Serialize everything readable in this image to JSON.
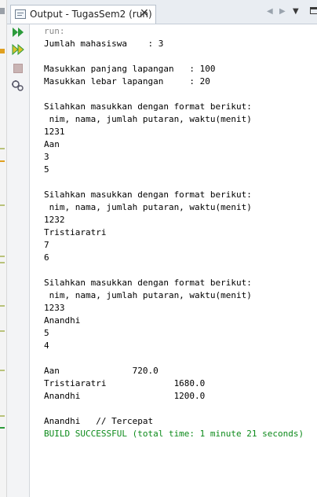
{
  "tab": {
    "title": "Output - TugasSem2 (run)",
    "close_glyph": "✕"
  },
  "nav": {
    "prev_glyph": "◀",
    "next_glyph": "▶",
    "menu_glyph": "▼"
  },
  "toolbar": {
    "rerun_icon": "double-play-icon",
    "rerun_options_icon": "double-play-outline-icon",
    "stop_icon": "stop-icon",
    "settings_icon": "settings-icon",
    "accent": "#2c9b3b"
  },
  "output": {
    "lines": [
      "run:",
      "Jumlah mahasiswa    : 3",
      "",
      "Masukkan panjang lapangan   : 100",
      "Masukkan lebar lapangan     : 20",
      "",
      "Silahkan masukkan dengan format berikut:",
      " nim, nama, jumlah putaran, waktu(menit)",
      "1231",
      "Aan",
      "3",
      "5",
      "",
      "Silahkan masukkan dengan format berikut:",
      " nim, nama, jumlah putaran, waktu(menit)",
      "1232",
      "Tristiaratri",
      "7",
      "6",
      "",
      "Silahkan masukkan dengan format berikut:",
      " nim, nama, jumlah putaran, waktu(menit)",
      "1233",
      "Anandhi",
      "5",
      "4",
      "",
      "Aan              720.0",
      "Tristiaratri             1680.0",
      "Anandhi                  1200.0",
      "",
      "Anandhi   // Tercepat",
      "BUILD SUCCESSFUL (total time: 1 minute 21 seconds)"
    ],
    "colors": {
      "run": "#8a8a8a",
      "normal": "#000000",
      "success": "#0c8a1a"
    }
  }
}
